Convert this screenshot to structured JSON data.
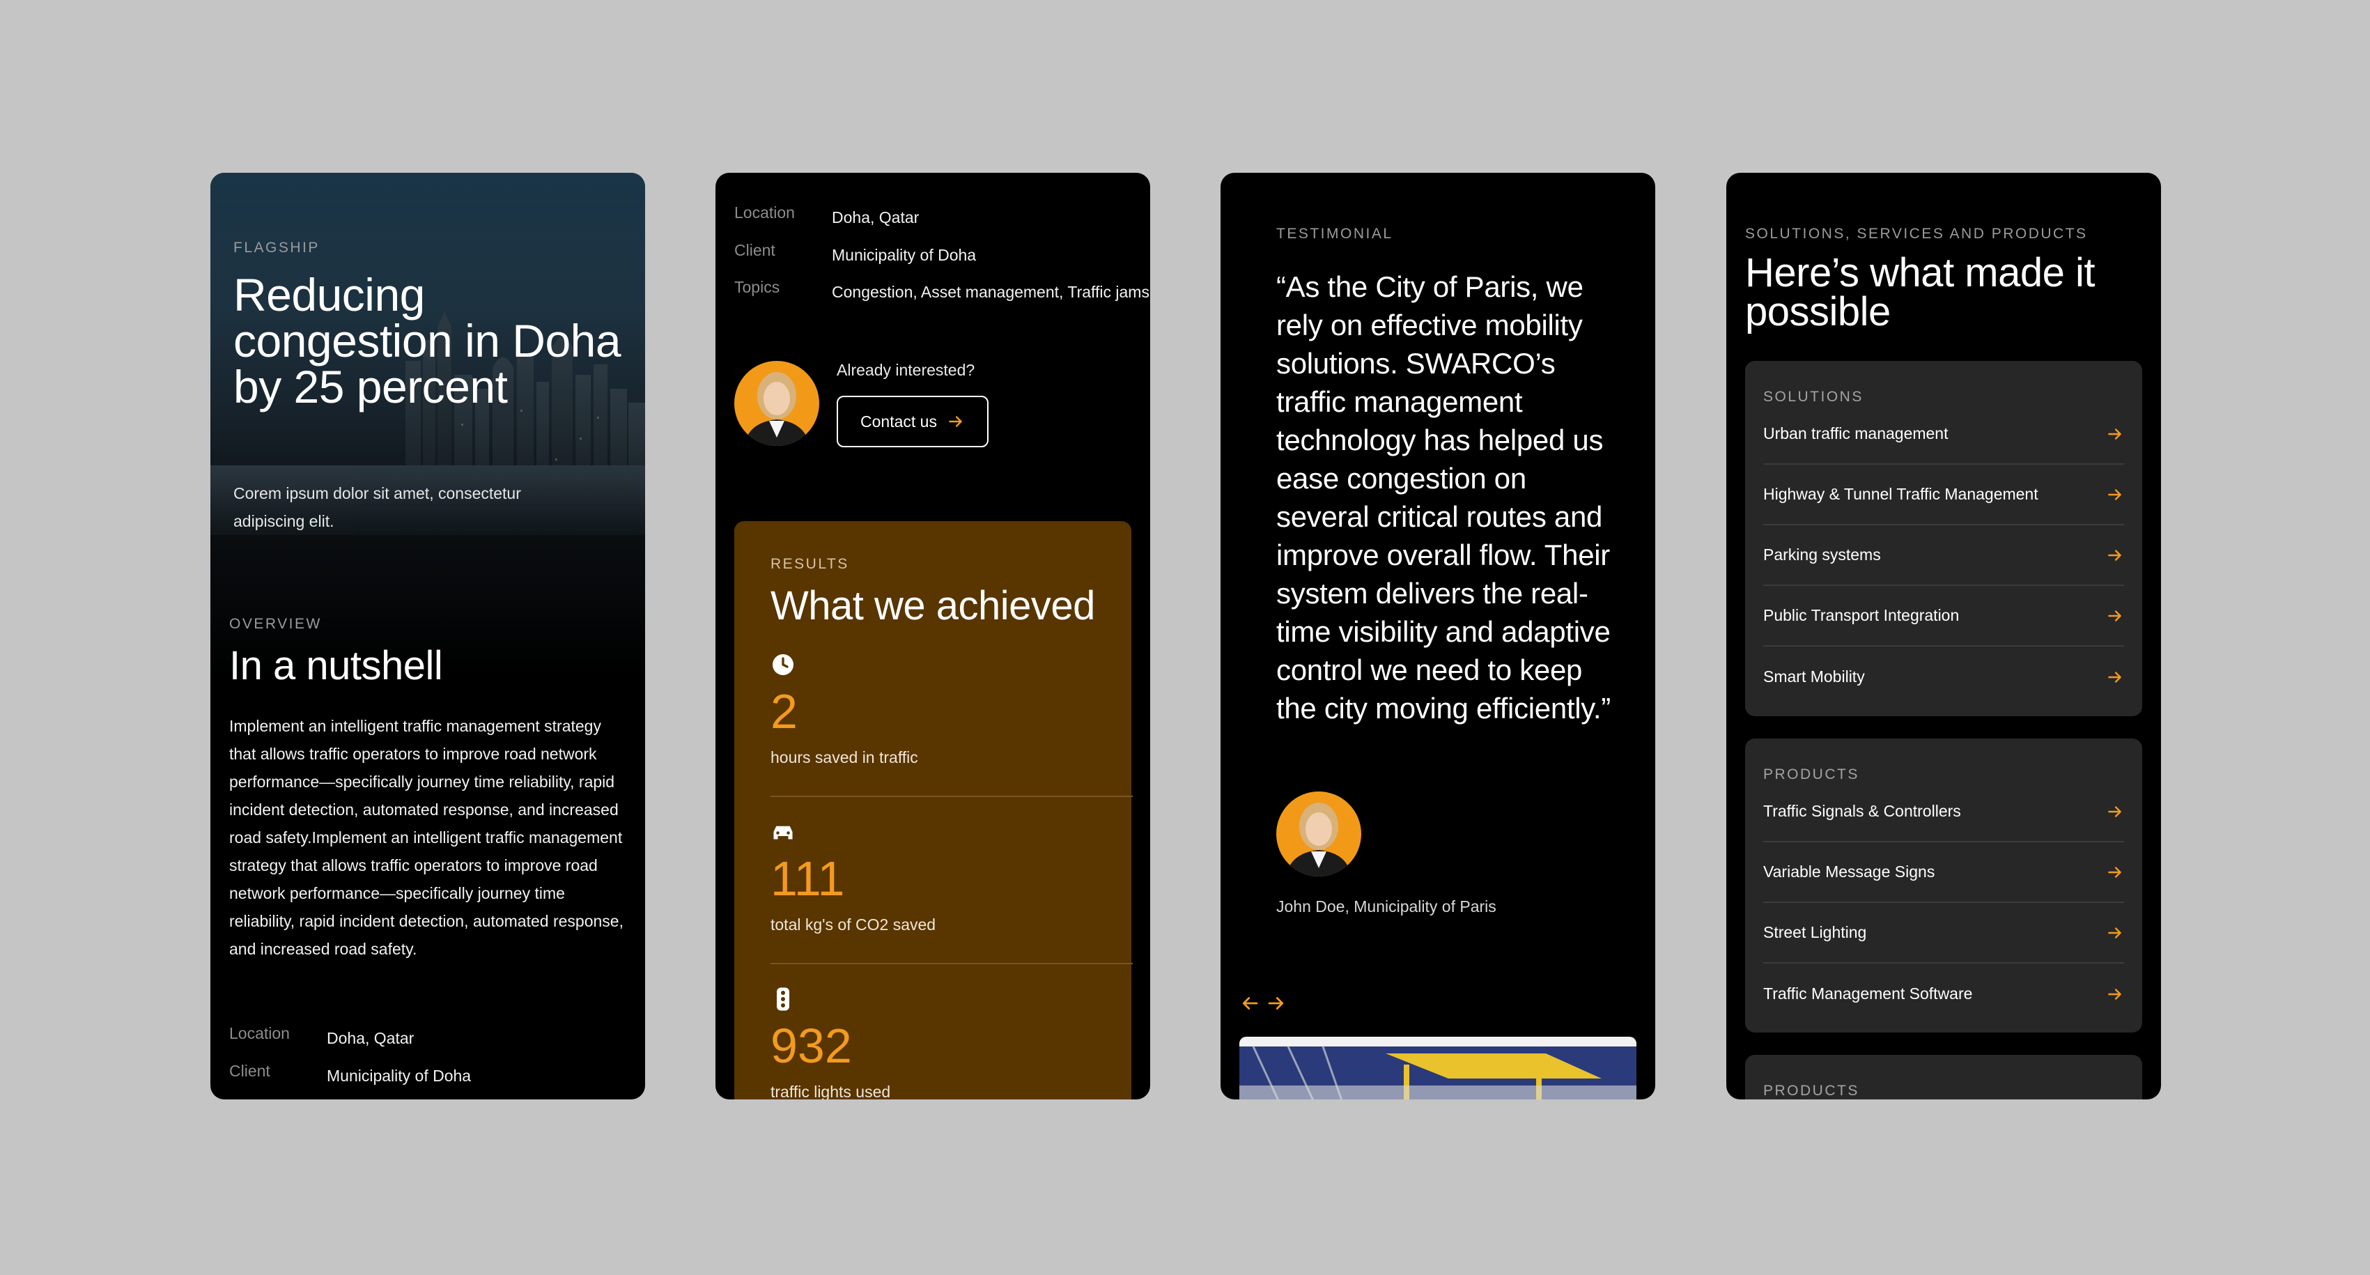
{
  "colors": {
    "accent": "#f39a1f",
    "results_bg": "#593500",
    "panel_bg": "#272727",
    "canvas": "#c5c5c5"
  },
  "screen1": {
    "eyebrow": "FLAGSHIP",
    "title": "Reducing congestion in Doha by 25 percent",
    "subtitle": "Corem ipsum dolor sit amet, consectetur adipiscing elit.",
    "overview_eyebrow": "OVERVIEW",
    "overview_title": "In a nutshell",
    "overview_body": "Implement an intelligent traffic management strategy that allows traffic operators to improve road network performance—specifically journey time reliability, rapid incident detection, automated response, and  increased road safety.Implement an intelligent traffic management strategy that allows traffic operators to improve road network performance—specifically journey time reliability, rapid incident detection, automated response, and increased road safety.",
    "meta": [
      {
        "label": "Location",
        "value": "Doha, Qatar"
      },
      {
        "label": "Client",
        "value": "Municipality of Doha"
      }
    ]
  },
  "screen2": {
    "meta": [
      {
        "label": "Location",
        "value": "Doha, Qatar"
      },
      {
        "label": "Client",
        "value": "Municipality of Doha"
      },
      {
        "label": "Topics",
        "value": "Congestion, Asset management, Traffic jams"
      }
    ],
    "cta_prompt": "Already interested?",
    "contact_label": "Contact us",
    "results_eyebrow": "RESULTS",
    "results_title": "What we achieved",
    "stats": [
      {
        "icon": "clock-icon",
        "value": "2",
        "label": "hours saved in traffic"
      },
      {
        "icon": "car-icon",
        "value": "111",
        "label": "total kg's of CO2 saved"
      },
      {
        "icon": "traffic-light-icon",
        "value": "932",
        "label": "traffic lights used"
      }
    ]
  },
  "screen3": {
    "eyebrow": "TESTIMONIAL",
    "quote": "“As the City of Paris, we rely on effective mobility solutions. SWARCO’s traffic management technology has helped us ease congestion on several critical routes and improve overall flow. Their system delivers the real-time visibility and adaptive control we need to keep the city moving efficiently.”",
    "author": "John Doe, Municipality of Paris"
  },
  "screen4": {
    "eyebrow": "SOLUTIONS, SERVICES AND PRODUCTS",
    "title": "Here’s what made it possible",
    "solutions_title": "SOLUTIONS",
    "solutions": [
      "Urban traffic management",
      "Highway & Tunnel Traffic Management",
      "Parking systems",
      "Public Transport Integration",
      "Smart Mobility"
    ],
    "products_title": "PRODUCTS",
    "products": [
      "Traffic Signals & Controllers",
      "Variable Message Signs",
      "Street Lighting",
      "Traffic Management Software"
    ],
    "products2_title": "PRODUCTS"
  }
}
